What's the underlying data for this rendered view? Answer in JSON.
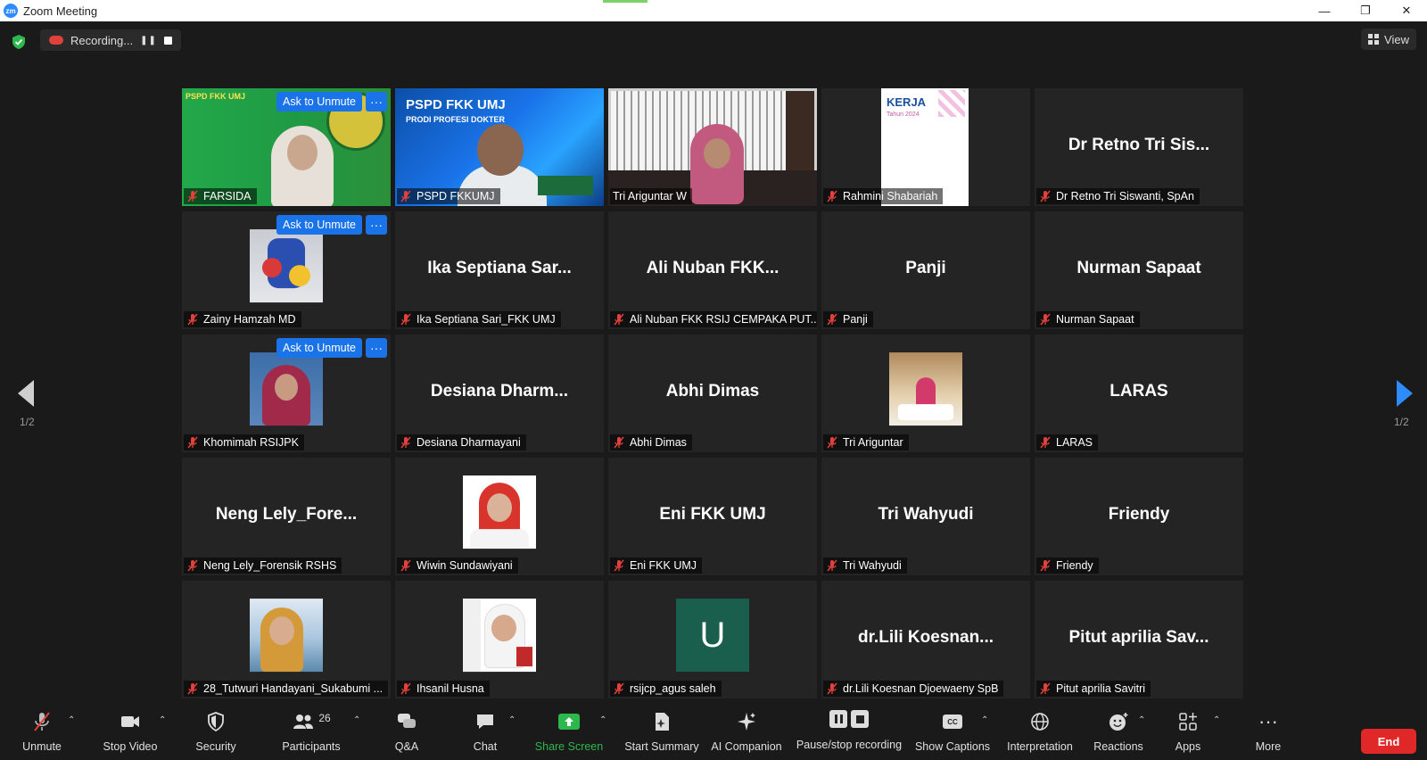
{
  "window": {
    "title": "Zoom Meeting",
    "minimize": "—",
    "maximize": "❐",
    "close": "✕"
  },
  "recording": {
    "label": "Recording..."
  },
  "view": {
    "label": "View"
  },
  "paging": {
    "left": "1/2",
    "right": "1/2"
  },
  "ask_to_unmute": "Ask to Unmute",
  "more_dots": "···",
  "tiles": [
    {
      "label": "FARSIDA",
      "big": "",
      "kind": "video-green"
    },
    {
      "label": "PSPD FKKUMJ",
      "big": "",
      "kind": "video-blue",
      "banner": "PSPD FKK UMJ",
      "banner_sub": "PRODI PROFESI DOKTER"
    },
    {
      "label": "Tri Ariguntar W",
      "big": "",
      "kind": "video-room"
    },
    {
      "label": "Rahmini Shabariah",
      "big": "",
      "kind": "screen",
      "screen_text": "KERJA",
      "screen_sub": "Tahun 2024"
    },
    {
      "label": "Dr Retno Tri Siswanti, SpAn",
      "big": "Dr Retno Tri Sis..."
    },
    {
      "label": "Zainy Hamzah MD",
      "big": "",
      "kind": "photo-moto"
    },
    {
      "label": "Ika Septiana Sari_FKK UMJ",
      "big": "Ika Septiana Sar..."
    },
    {
      "label": "Ali Nuban FKK RSIJ CEMPAKA PUT...",
      "big": "Ali Nuban FKK..."
    },
    {
      "label": "Panji",
      "big": "Panji"
    },
    {
      "label": "Nurman Sapaat",
      "big": "Nurman Sapaat"
    },
    {
      "label": "Khomimah RSIJPK",
      "big": "",
      "kind": "photo-hijab-red"
    },
    {
      "label": "Desiana Dharmayani",
      "big": "Desiana  Dharm..."
    },
    {
      "label": "Abhi Dimas",
      "big": "Abhi Dimas"
    },
    {
      "label": "Tri Ariguntar",
      "big": "",
      "kind": "photo-room"
    },
    {
      "label": "LARAS",
      "big": "LARAS"
    },
    {
      "label": "Neng Lely_Forensik RSHS",
      "big": "Neng  Lely_Fore..."
    },
    {
      "label": "Wiwin Sundawiyani",
      "big": "",
      "kind": "photo-white"
    },
    {
      "label": "Eni FKK UMJ",
      "big": "Eni FKK UMJ"
    },
    {
      "label": "Tri Wahyudi",
      "big": "Tri Wahyudi"
    },
    {
      "label": "Friendy",
      "big": "Friendy"
    },
    {
      "label": "28_Tutwuri Handayani_Sukabumi ...",
      "big": "",
      "kind": "photo-sea"
    },
    {
      "label": "Ihsanil Husna",
      "big": "",
      "kind": "photo-poster"
    },
    {
      "label": "rsijcp_agus saleh",
      "big": "",
      "kind": "avatar-u",
      "initial": "U"
    },
    {
      "label": "dr.Lili Koesnan Djoewaeny SpB",
      "big": "dr.Lili  Koesnan..."
    },
    {
      "label": "Pitut aprilia Savitri",
      "big": "Pitut  aprilia  Sav..."
    }
  ],
  "toolbar": {
    "unmute": "Unmute",
    "stop_video": "Stop Video",
    "security": "Security",
    "participants": "Participants",
    "participants_count": "26",
    "qa": "Q&A",
    "chat": "Chat",
    "share_screen": "Share Screen",
    "start_summary": "Start Summary",
    "ai_companion": "AI Companion",
    "pause_recording": "Pause/stop recording",
    "show_captions": "Show Captions",
    "interpretation": "Interpretation",
    "reactions": "Reactions",
    "apps": "Apps",
    "more": "More",
    "end": "End",
    "cc": "CC"
  },
  "colors": {
    "accent_blue": "#1a73e8",
    "active_speaker": "#c4e34a",
    "share_green": "#2db84d",
    "end_red": "#e02828"
  }
}
